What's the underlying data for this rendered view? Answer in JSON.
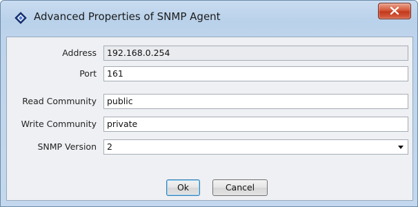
{
  "window": {
    "title": "Advanced Properties of SNMP Agent",
    "close_label": "x",
    "icon": "diamond-app-icon"
  },
  "form": {
    "address": {
      "label": "Address",
      "value": "192.168.0.254"
    },
    "port": {
      "label": "Port",
      "value": "161"
    },
    "read_community": {
      "label": "Read Community",
      "value": "public"
    },
    "write_community": {
      "label": "Write Community",
      "value": "private"
    },
    "snmp_version": {
      "label": "SNMP Version",
      "value": "2"
    }
  },
  "buttons": {
    "ok_label": "Ok",
    "cancel_label": "Cancel"
  },
  "colors": {
    "titlebar": "#bed4ec",
    "close_button": "#c2391d",
    "dialog_body": "#eef0f3",
    "default_button_border": "#3c7fb1"
  }
}
